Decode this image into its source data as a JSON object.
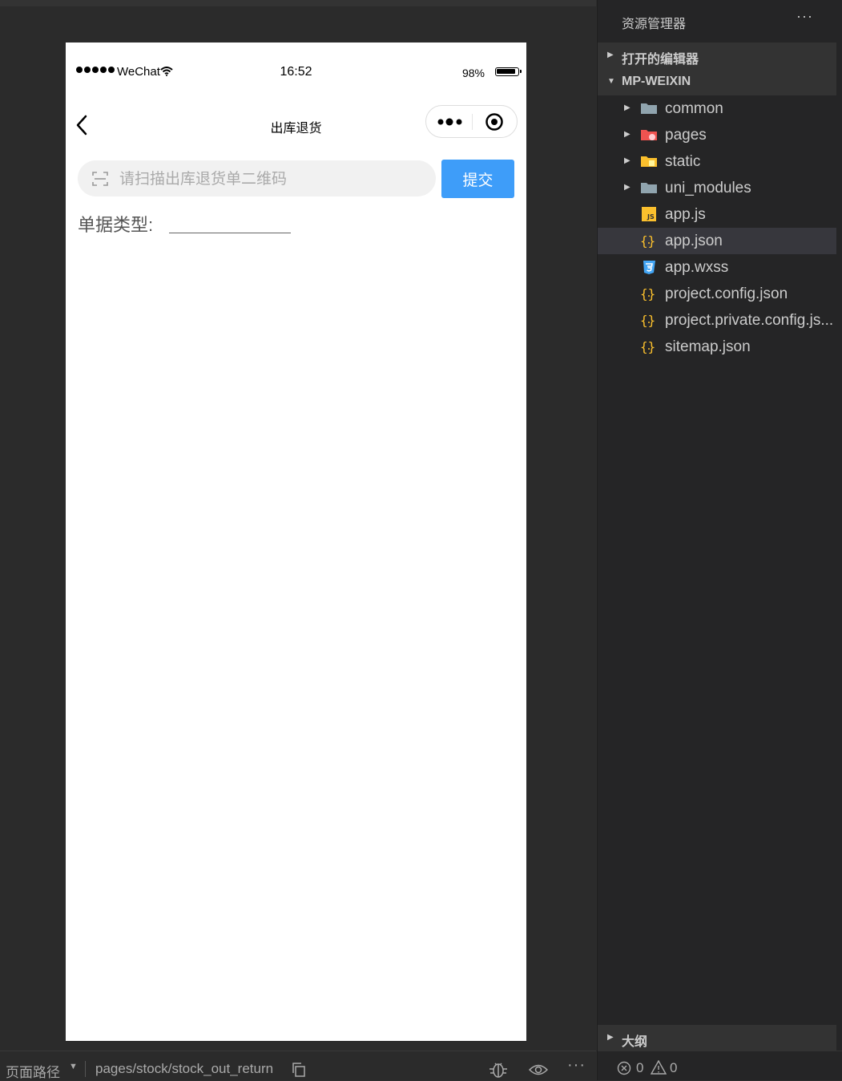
{
  "status_bar": {
    "carrier": "WeChat",
    "time": "16:52",
    "battery": "98%"
  },
  "nav": {
    "title": "出库退货"
  },
  "scan": {
    "placeholder": "请扫描出库退货单二维码",
    "value": ""
  },
  "submit_label": "提交",
  "doc_type": {
    "label": "单据类型:",
    "value": ""
  },
  "bottom_bar": {
    "path_label": "页面路径",
    "path_value": "pages/stock/stock_out_return"
  },
  "explorer": {
    "title": "资源管理器",
    "open_editors": "打开的编辑器",
    "project": "MP-WEIXIN",
    "outline": "大纲",
    "items": [
      {
        "name": "common",
        "icon": "folder-icon",
        "folder": true
      },
      {
        "name": "pages",
        "icon": "folder-pages-icon",
        "folder": true
      },
      {
        "name": "static",
        "icon": "folder-static-icon",
        "folder": true
      },
      {
        "name": "uni_modules",
        "icon": "folder-icon",
        "folder": true
      },
      {
        "name": "app.js",
        "icon": "js-file-icon",
        "folder": false
      },
      {
        "name": "app.json",
        "icon": "json-file-icon",
        "folder": false,
        "selected": true
      },
      {
        "name": "app.wxss",
        "icon": "css-file-icon",
        "folder": false
      },
      {
        "name": "project.config.json",
        "icon": "json-file-icon",
        "folder": false
      },
      {
        "name": "project.private.config.js...",
        "icon": "json-file-icon",
        "folder": false
      },
      {
        "name": "sitemap.json",
        "icon": "json-file-icon",
        "folder": false
      }
    ]
  },
  "problems": {
    "errors": "0",
    "warnings": "0"
  },
  "colors": {
    "accent": "#3e9df9",
    "sidebar_bg": "#252526",
    "selected_row": "#37373d"
  }
}
